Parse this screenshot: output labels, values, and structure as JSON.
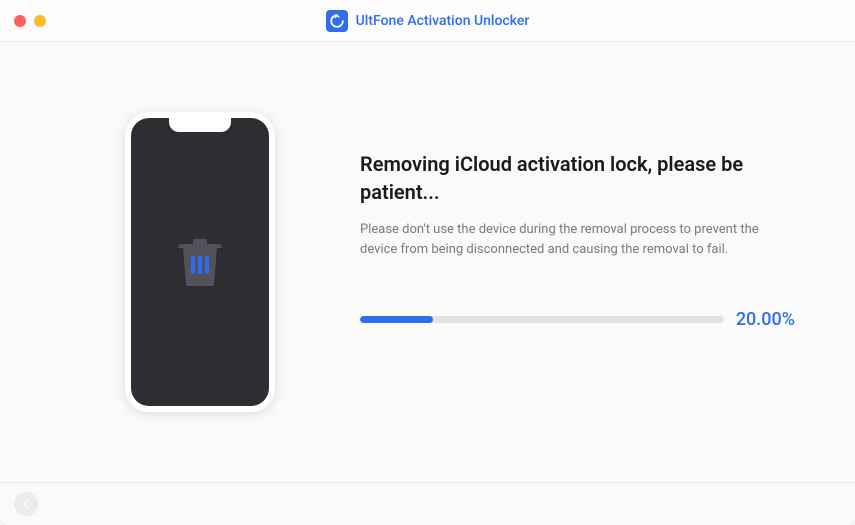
{
  "app": {
    "name": "UltFone Activation Unlocker"
  },
  "main": {
    "heading": "Removing iCloud activation lock, please be patient...",
    "subtext": "Please don't use the device during the removal process to prevent the device from being disconnected and causing the removal to fail.",
    "progress_pct_label": "20.00%",
    "progress_value": 20
  },
  "colors": {
    "accent": "#2f6df0"
  }
}
